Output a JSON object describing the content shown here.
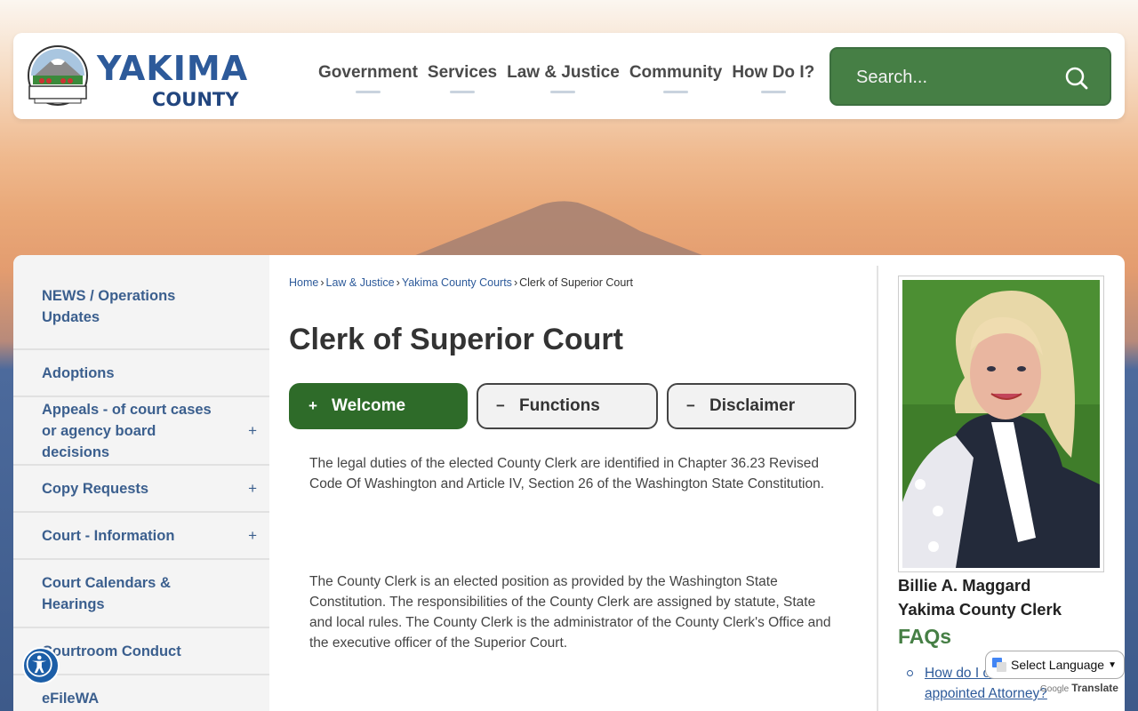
{
  "logo": {
    "main": "YAKIMA",
    "sub": "COUNTY",
    "seal_text": "YAKIMA"
  },
  "nav": {
    "items": [
      {
        "label": "Government"
      },
      {
        "label": "Services"
      },
      {
        "label": "Law & Justice"
      },
      {
        "label": "Community"
      },
      {
        "label": "How Do I?"
      }
    ]
  },
  "search": {
    "placeholder": "Search...",
    "icon": "search-icon"
  },
  "sidebar": {
    "items": [
      {
        "label": "NEWS / Operations Updates",
        "expandable": false
      },
      {
        "label": "Adoptions",
        "expandable": false
      },
      {
        "label": "Appeals - of court cases or agency board decisions",
        "expandable": true
      },
      {
        "label": "Copy Requests",
        "expandable": true
      },
      {
        "label": "Court - Information",
        "expandable": true
      },
      {
        "label": "Court Calendars & Hearings",
        "expandable": false
      },
      {
        "label": "Courtroom Conduct",
        "expandable": false
      },
      {
        "label": "eFileWA",
        "expandable": false
      }
    ],
    "expand_symbol": "+"
  },
  "breadcrumb": {
    "items": [
      "Home",
      "Law & Justice",
      "Yakima County Courts"
    ],
    "current": "Clerk of Superior Court",
    "separator": "›"
  },
  "page": {
    "title": "Clerk of Superior Court"
  },
  "tabs": [
    {
      "label": "Welcome",
      "symbol": "+",
      "active": true
    },
    {
      "label": "Functions",
      "symbol": "−",
      "active": false
    },
    {
      "label": "Disclaimer",
      "symbol": "−",
      "active": false
    }
  ],
  "content": {
    "paragraph1": "The legal duties of the elected County Clerk are identified in Chapter 36.23 Revised Code Of Washington and Article IV, Section 26 of the Washington State Constitution.",
    "paragraph2": "The County Clerk is an elected position as provided by the Washington State Constitution. The responsibilities of the County Clerk are assigned by statute, State and local rules. The County Clerk is the administrator of the County Clerk's Office and the executive officer of the Superior Court."
  },
  "profile": {
    "name": "Billie A. Maggard",
    "title": "Yakima County Clerk"
  },
  "faqs": {
    "title": "FAQs",
    "items": [
      "How do I obtain court appointed Attorney?"
    ]
  },
  "translate": {
    "select_label": "Select Language",
    "powered_by": "Google",
    "translate_label": "Translate"
  },
  "colors": {
    "brand_green": "#467f45",
    "tab_active": "#2e6b29",
    "link_blue": "#2d5a9a",
    "sidebar_text": "#3b5f8e"
  }
}
